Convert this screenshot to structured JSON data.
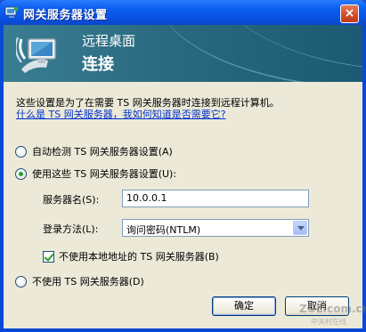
{
  "window": {
    "title": "网关服务器设置",
    "close_glyph": "×"
  },
  "banner": {
    "subtitle": "远程桌面",
    "title": "连接"
  },
  "description": "这些设置是为了在需要 TS 网关服务器时连接到远程计算机。",
  "help_link": "什么是 TS 网关服务器，我如何知道是否需要它?",
  "options": {
    "auto_detect": {
      "label": "自动检测 TS 网关服务器设置(A)",
      "checked": false
    },
    "use_settings": {
      "label": "使用这些 TS 网关服务器设置(U):",
      "checked": true
    },
    "no_gateway": {
      "label": "不使用 TS 网关服务器(D)",
      "checked": false
    }
  },
  "server": {
    "label": "服务器名(S):",
    "value": "10.0.0.1"
  },
  "logon": {
    "label": "登录方法(L):",
    "value": "询问密码(NTLM)"
  },
  "bypass": {
    "label": "不使用本地地址的 TS 网关服务器(B)",
    "checked": true
  },
  "buttons": {
    "ok": "确定",
    "cancel": "取消"
  },
  "watermark": {
    "line1": "ZOL.com.cn",
    "line2": "中关村在线"
  }
}
